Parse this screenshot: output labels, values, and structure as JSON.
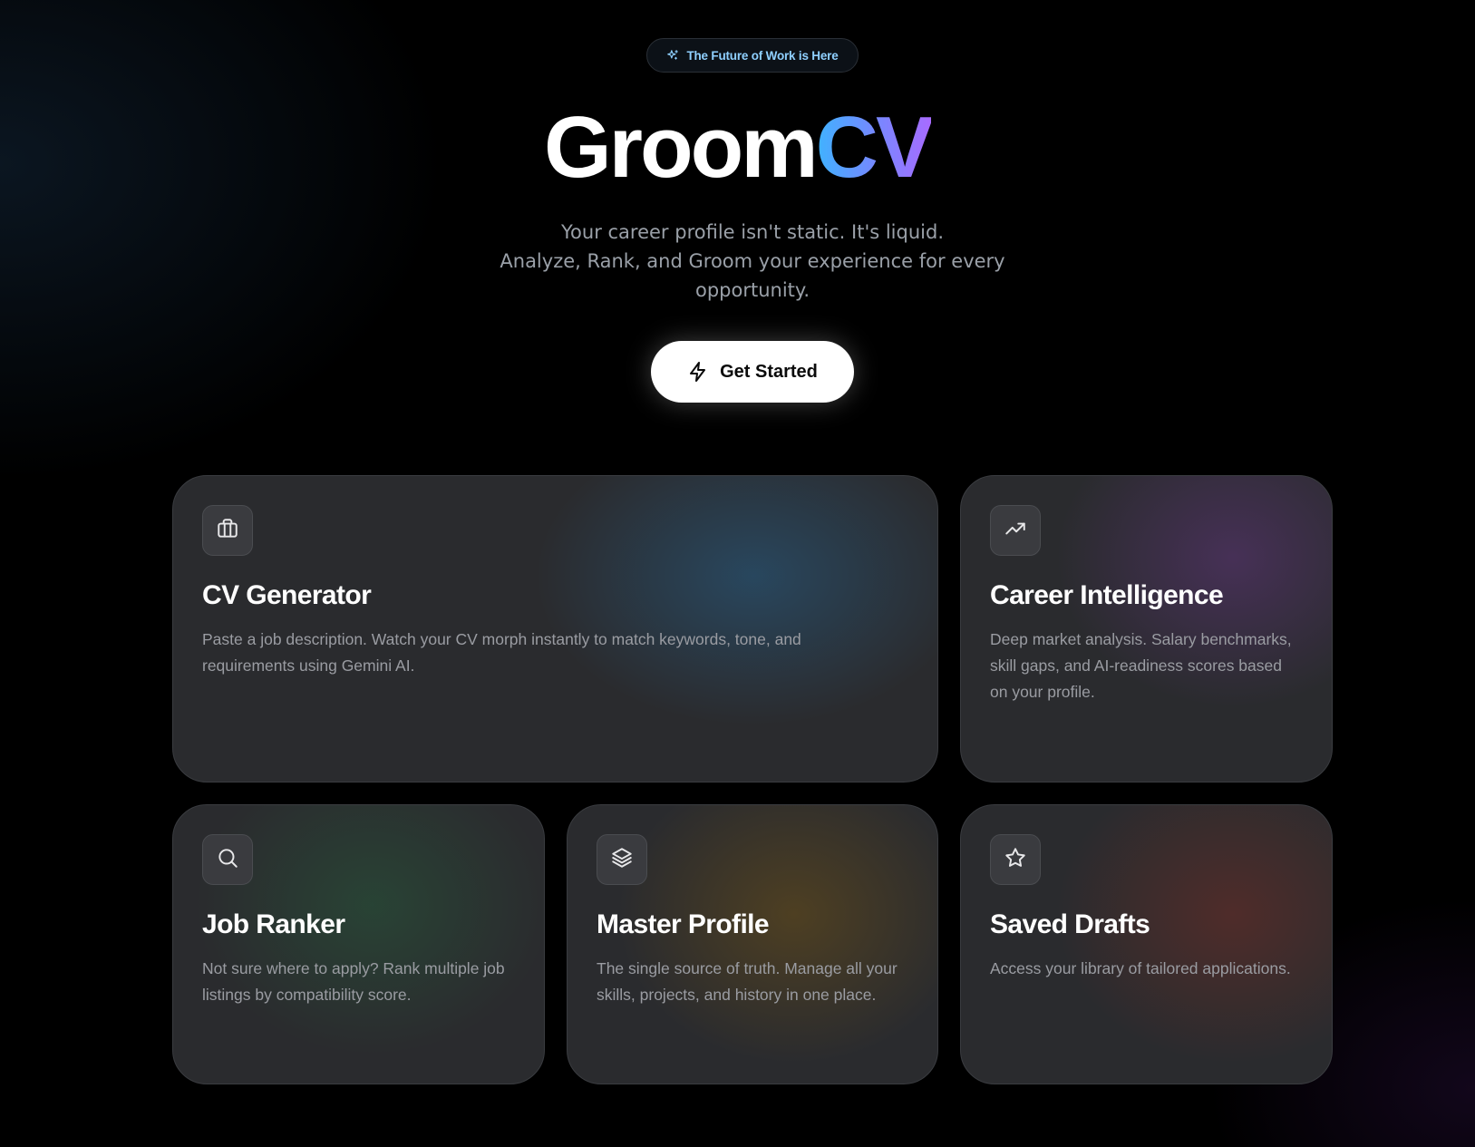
{
  "badge": {
    "text": "The Future of Work is Here",
    "icon": "sparkles-icon"
  },
  "hero": {
    "title_part1": "Groom",
    "title_part2": "CV",
    "subtitle_line1": "Your career profile isn't static. It's liquid.",
    "subtitle_line2": "Analyze, Rank, and Groom your experience for every opportunity."
  },
  "cta": {
    "label": "Get Started",
    "icon": "lightning-icon"
  },
  "features": [
    {
      "title": "CV Generator",
      "description": "Paste a job description. Watch your CV morph instantly to match keywords, tone, and requirements using Gemini AI.",
      "icon": "briefcase-icon",
      "glow_color": "#28506e"
    },
    {
      "title": "Career Intelligence",
      "description": "Deep market analysis. Salary benchmarks, skill gaps, and AI-readiness scores based on your profile.",
      "icon": "trending-up-icon",
      "glow_color": "#503264"
    },
    {
      "title": "Job Ranker",
      "description": "Not sure where to apply? Rank multiple job listings by compatibility score.",
      "icon": "search-icon",
      "glow_color": "#284b37"
    },
    {
      "title": "Master Profile",
      "description": "The single source of truth. Manage all your skills, projects, and history in one place.",
      "icon": "layers-icon",
      "glow_color": "#5a461e"
    },
    {
      "title": "Saved Drafts",
      "description": "Access your library of tailored applications.",
      "icon": "star-icon",
      "glow_color": "#5f2d28"
    }
  ]
}
